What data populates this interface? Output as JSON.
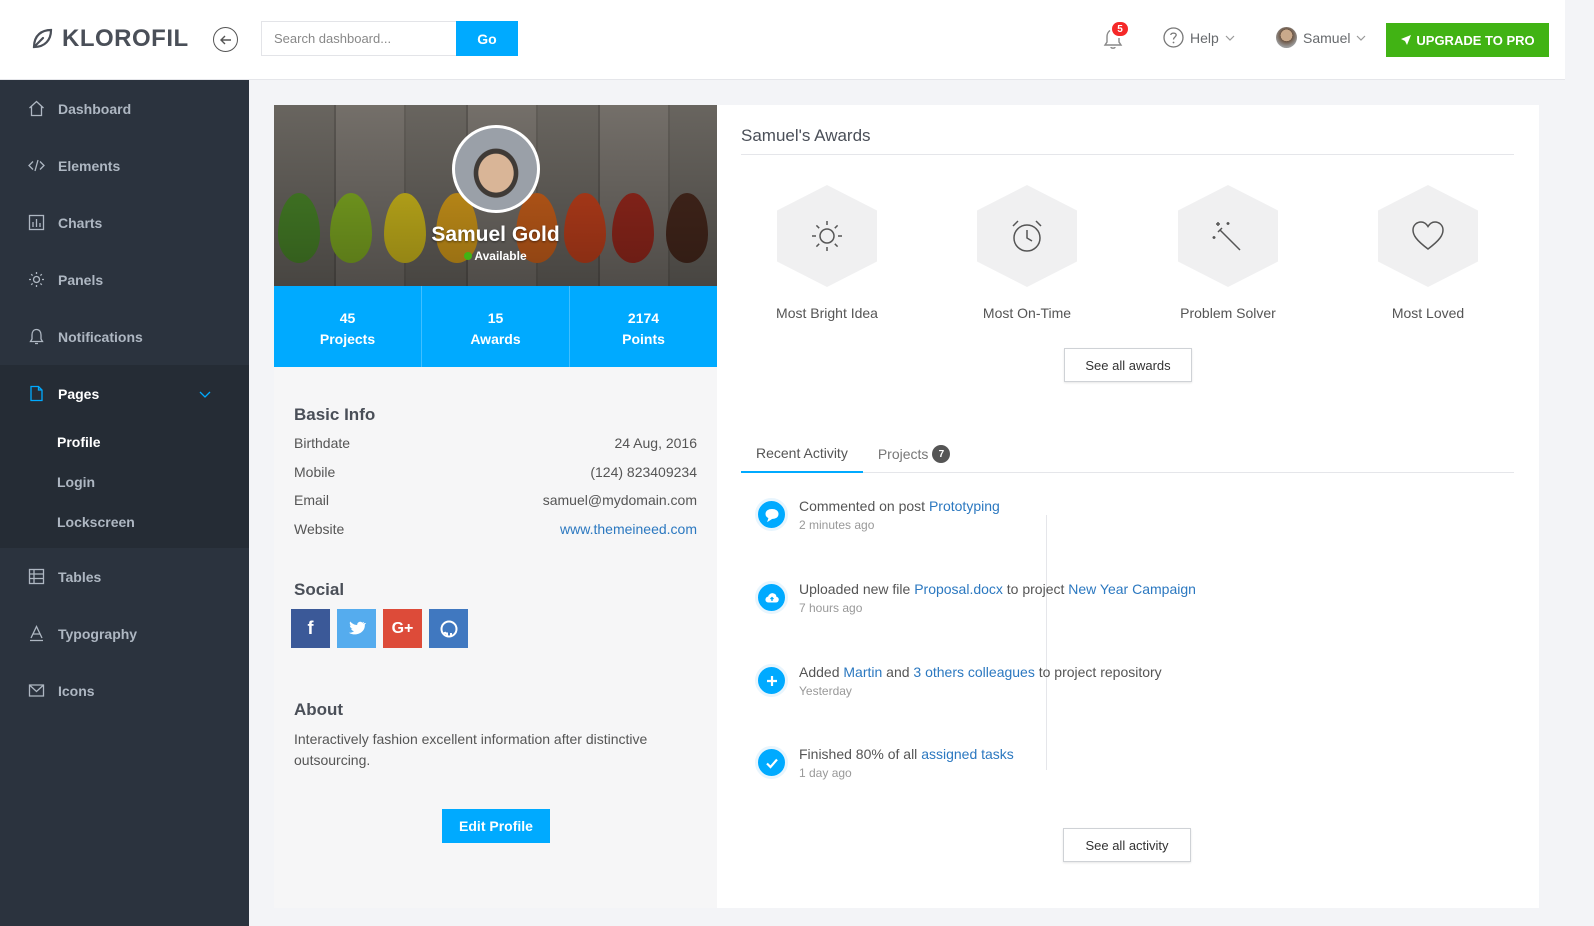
{
  "brand": {
    "name": "KLOROFIL"
  },
  "search": {
    "placeholder": "Search dashboard...",
    "button": "Go"
  },
  "topnav": {
    "notifications_count": "5",
    "help_label": "Help",
    "user_name": "Samuel",
    "upgrade_label": "UPGRADE TO PRO"
  },
  "sidebar": {
    "items": [
      {
        "label": "Dashboard",
        "icon": "home-icon"
      },
      {
        "label": "Elements",
        "icon": "code-icon"
      },
      {
        "label": "Charts",
        "icon": "chart-bars-icon"
      },
      {
        "label": "Panels",
        "icon": "cog-icon"
      },
      {
        "label": "Notifications",
        "icon": "bell-icon"
      },
      {
        "label": "Pages",
        "icon": "file-icon"
      },
      {
        "label": "Tables",
        "icon": "table-icon"
      },
      {
        "label": "Typography",
        "icon": "text-format-icon"
      },
      {
        "label": "Icons",
        "icon": "linearicons-icon"
      }
    ],
    "pages_sub": [
      "Profile",
      "Login",
      "Lockscreen"
    ]
  },
  "profile": {
    "name": "Samuel Gold",
    "status": "Available",
    "stats": [
      {
        "value": "45",
        "label": "Projects"
      },
      {
        "value": "15",
        "label": "Awards"
      },
      {
        "value": "2174",
        "label": "Points"
      }
    ],
    "basic_info_title": "Basic Info",
    "basic_info": [
      {
        "label": "Birthdate",
        "value": "24 Aug, 2016"
      },
      {
        "label": "Mobile",
        "value": "(124) 823409234"
      },
      {
        "label": "Email",
        "value": "samuel@mydomain.com"
      },
      {
        "label": "Website",
        "value": "www.themeineed.com"
      }
    ],
    "social_title": "Social",
    "social_colors": {
      "facebook": "#3b5998",
      "twitter": "#55acee",
      "google": "#dd4b39",
      "github": "#4078c0"
    },
    "about_title": "About",
    "about_text": "Interactively fashion excellent information after distinctive outsourcing.",
    "edit_button": "Edit Profile"
  },
  "awards": {
    "title": "Samuel's Awards",
    "items": [
      {
        "label": "Most Bright Idea",
        "icon": "sun-icon"
      },
      {
        "label": "Most On-Time",
        "icon": "alarm-icon"
      },
      {
        "label": "Problem Solver",
        "icon": "magic-wand-icon"
      },
      {
        "label": "Most Loved",
        "icon": "heart-icon"
      }
    ],
    "see_all": "See all awards"
  },
  "tabs": {
    "recent": "Recent Activity",
    "projects": "Projects",
    "projects_count": "7"
  },
  "activity": [
    {
      "pre": "Commented on post ",
      "link1": "Prototyping",
      "mid": "",
      "link2": "",
      "post": "",
      "time": "2 minutes ago",
      "icon": "comment-icon"
    },
    {
      "pre": "Uploaded new file ",
      "link1": "Proposal.docx",
      "mid": " to project ",
      "link2": "New Year Campaign",
      "post": "",
      "time": "7 hours ago",
      "icon": "cloud-upload-icon"
    },
    {
      "pre": "Added ",
      "link1": "Martin",
      "mid": " and ",
      "link2": "3 others colleagues",
      "post": " to project repository",
      "time": "Yesterday",
      "icon": "plus-icon"
    },
    {
      "pre": "Finished 80% of all ",
      "link1": "assigned tasks",
      "mid": "",
      "link2": "",
      "post": "",
      "time": "1 day ago",
      "icon": "check-icon"
    }
  ],
  "see_all_activity": "See all activity"
}
